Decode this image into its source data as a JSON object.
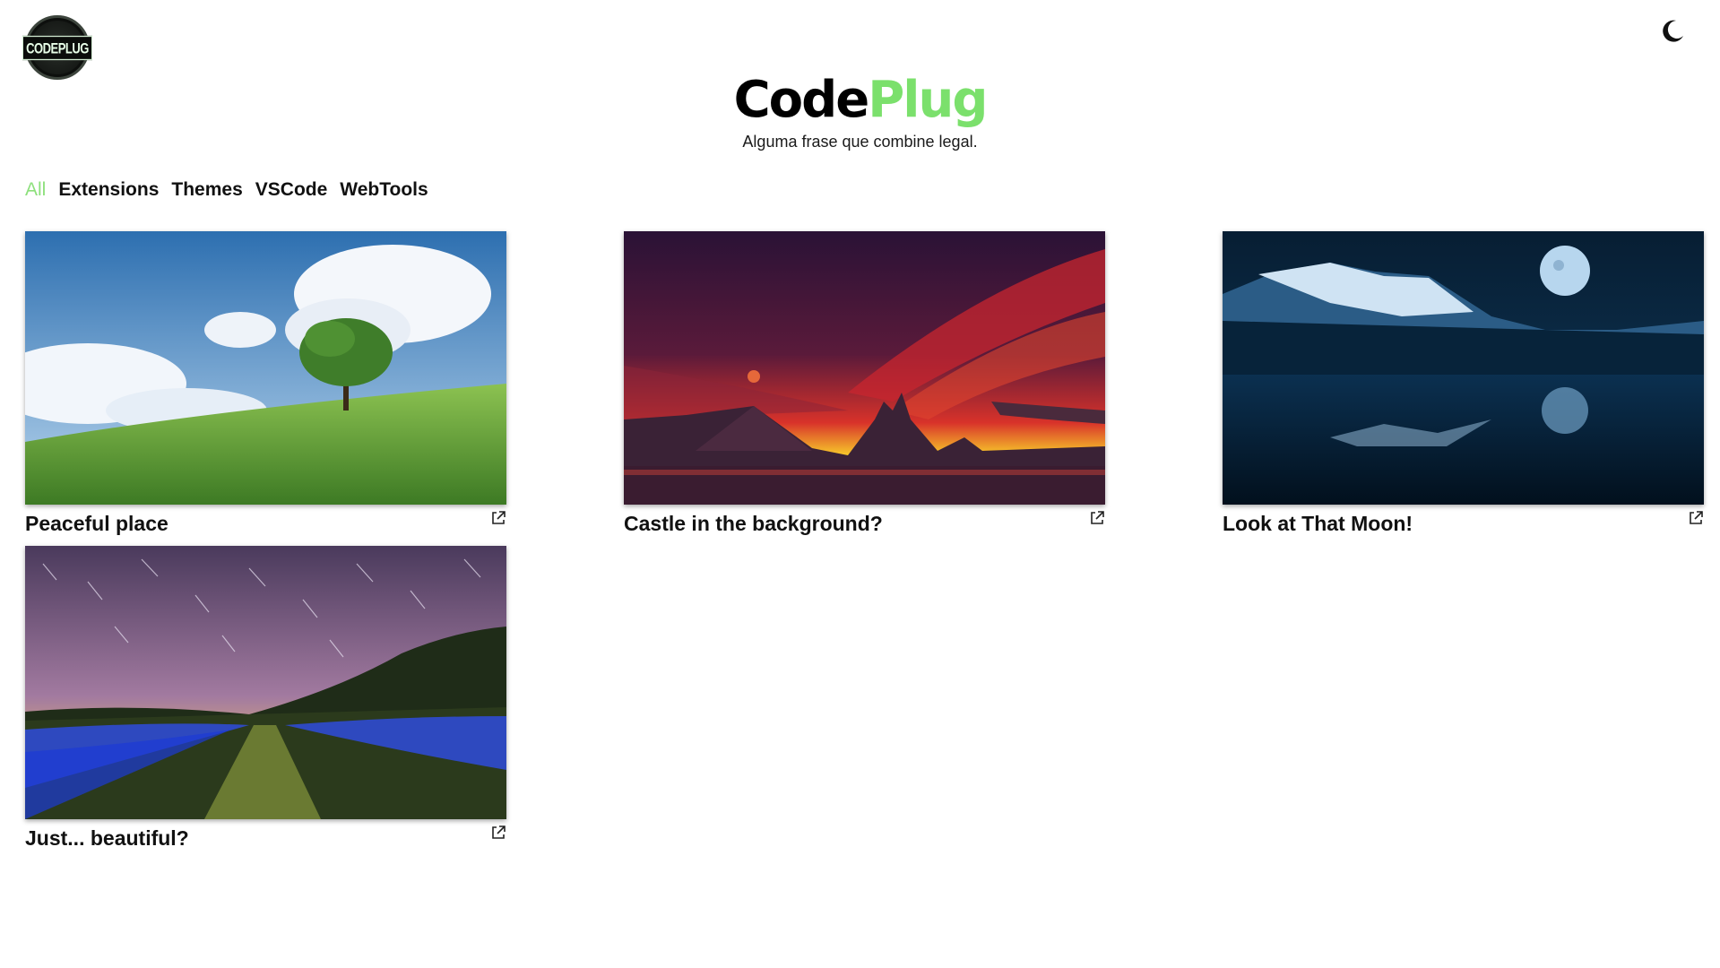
{
  "logo": {
    "text": "CODEPLUG"
  },
  "theme_toggle": {
    "icon": "moon-icon"
  },
  "brand": {
    "title_part1": "Code",
    "title_part2": "Plug",
    "tagline": "Alguma frase que combine legal.",
    "accent_color": "#7be06c"
  },
  "filters": [
    {
      "label": "All",
      "active": true
    },
    {
      "label": "Extensions",
      "active": false
    },
    {
      "label": "Themes",
      "active": false
    },
    {
      "label": "VSCode",
      "active": false
    },
    {
      "label": "WebTools",
      "active": false
    }
  ],
  "cards": [
    {
      "title": "Peaceful place",
      "image": "landscape-tree-icon",
      "link_icon": "external-link-icon"
    },
    {
      "title": "Castle in the background?",
      "image": "castle-sunset-icon",
      "link_icon": "external-link-icon"
    },
    {
      "title": "Look at That Moon!",
      "image": "moon-lake-icon",
      "link_icon": "external-link-icon"
    },
    {
      "title": "Just... beautiful?",
      "image": "star-trails-field-icon",
      "link_icon": "external-link-icon"
    }
  ]
}
